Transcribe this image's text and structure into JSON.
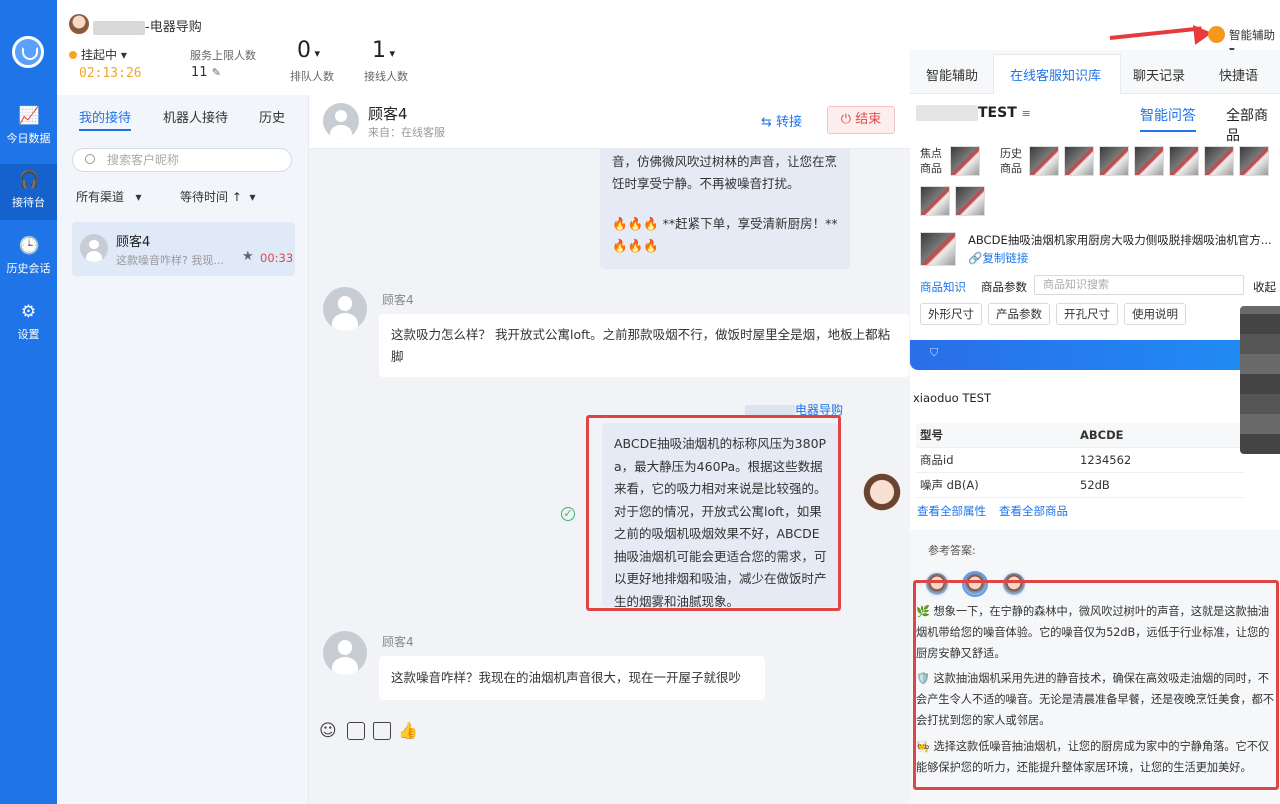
{
  "nav": {
    "items": [
      {
        "label": "今日数据",
        "icon": "chart-icon"
      },
      {
        "label": "接待台",
        "icon": "headset-icon"
      },
      {
        "label": "历史会话",
        "icon": "clock-icon"
      },
      {
        "label": "设置",
        "icon": "gear-icon"
      }
    ]
  },
  "header": {
    "store_suffix": "-电器导购",
    "status": "挂起中",
    "timer": "02:13:26",
    "service_limit_label": "服务上限人数",
    "service_limit_value": "11",
    "queue_value": "0",
    "queue_label": "排队人数",
    "online_value": "1",
    "online_label": "接线人数",
    "assist_label": "智能辅助"
  },
  "list": {
    "tabs": [
      "我的接待",
      "机器人接待",
      "历史"
    ],
    "search_placeholder": "搜索客户昵称",
    "filter_channel": "所有渠道",
    "filter_wait": "等待时间 ↑",
    "conversation": {
      "name": "顾客4",
      "preview": "这款噪音咋样? 我现...",
      "time": "00:33"
    }
  },
  "chat": {
    "customer": "顾客4",
    "source": "来自：在线客服",
    "transfer_label": "转接",
    "end_label": "结束",
    "messages": {
      "m1_top": "音，仿佛微风吹过树林的声音，让您在烹饪时享受宁静。不再被噪音打扰。",
      "m1_bottom": "🔥🔥🔥 **赶紧下单，享受清新厨房！** 🔥🔥🔥",
      "m2_sender": "顾客4",
      "m2_text": "这款吸力怎么样？ 我开放式公寓loft。之前那款吸烟不行，做饭时屋里全是烟，地板上都粘脚",
      "agent_suffix": "电器导购",
      "m3_text": "ABCDE抽吸油烟机的标称风压为380Pa，最大静压为460Pa。根据这些数据来看，它的吸力相对来说是比较强的。对于您的情况，开放式公寓loft，如果之前的吸烟机吸烟效果不好，ABCDE抽吸油烟机可能会更适合您的需求，可以更好地排烟和吸油，减少在做饭时产生的烟雾和油腻现象。",
      "m4_sender": "顾客4",
      "m4_text": "这款噪音咋样？我现在的油烟机声音很大，现在一开屋子就很吵"
    }
  },
  "right": {
    "tabs": [
      "智能辅助",
      "在线客服知识库",
      "聊天记录",
      "快捷语"
    ],
    "shop_title": "TEST",
    "sub_tabs": [
      "智能问答",
      "全部商品"
    ],
    "focus_label": "焦点商品",
    "history_label": "历史商品",
    "product_title": "ABCDE抽吸油烟机家用厨房大吸力侧吸脱排烟吸油机官方...",
    "copy_link": "复制链接",
    "kb_tabs": [
      "商品知识",
      "商品参数"
    ],
    "kb_placeholder": "商品知识搜索",
    "collapse": "收起",
    "chips": [
      "外形尺寸",
      "产品参数",
      "开孔尺寸",
      "使用说明"
    ],
    "shop_name": "xiaoduo TEST",
    "params": [
      {
        "k": "型号",
        "v": "ABCDE"
      },
      {
        "k": "商品id",
        "v": "1234562"
      },
      {
        "k": "噪声 dB(A)",
        "v": "52dB"
      }
    ],
    "link_all_props": "查看全部属性",
    "link_all_products": "查看全部商品",
    "ref_label": "参考答案:",
    "answers": [
      "🌿 想象一下，在宁静的森林中，微风吹过树叶的声音，这就是这款抽油烟机带给您的噪音体验。它的噪音仅为52dB，远低于行业标准，让您的厨房安静又舒适。",
      "🛡️ 这款抽油烟机采用先进的静音技术，确保在高效吸走油烟的同时，不会产生令人不适的噪音。无论是清晨准备早餐，还是夜晚烹饪美食，都不会打扰到您的家人或邻居。",
      "🧑‍🍳 选择这款低噪音抽油烟机，让您的厨房成为家中的宁静角落。它不仅能够保护您的听力，还能提升整体家居环境，让您的生活更加美好。"
    ]
  },
  "colors": {
    "brand": "#1f74e8",
    "alert": "#e04545",
    "status": "#f5a623"
  }
}
